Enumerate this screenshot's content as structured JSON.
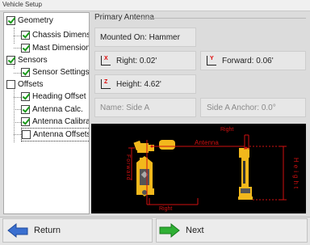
{
  "window": {
    "title": "Vehicle Setup"
  },
  "tree": {
    "items": [
      {
        "label": "Geometry",
        "checked": true
      },
      {
        "label": "Chassis Dimensions",
        "checked": true
      },
      {
        "label": "Mast Dimensions",
        "checked": true
      },
      {
        "label": "Sensors",
        "checked": true
      },
      {
        "label": "Sensor Settings",
        "checked": true
      },
      {
        "label": "Offsets",
        "checked": false
      },
      {
        "label": "Heading Offset",
        "checked": true
      },
      {
        "label": "Antenna Calc.",
        "checked": true
      },
      {
        "label": "Antenna Calibration",
        "checked": true
      },
      {
        "label": "Antenna Offsets",
        "checked": false
      }
    ]
  },
  "panel": {
    "title": "Primary Antenna",
    "mounted_on": "Mounted On: Hammer",
    "right": "Right: 0.02'",
    "forward": "Forward: 0.06'",
    "height": "Height: 4.62'",
    "name": "Name: Side A",
    "anchor": "Side A Anchor: 0.0°",
    "axis_x": "X",
    "axis_y": "Y",
    "axis_z": "Z"
  },
  "diagram": {
    "label_antenna": "Antenna",
    "label_right_top": "Right",
    "label_right_bottom": "Right",
    "label_forward": "Forward",
    "label_height": "Height",
    "colors": {
      "machine": "#f2b81c",
      "dimension": "#d01010",
      "background": "#000000"
    }
  },
  "footer": {
    "return_label": "Return",
    "next_label": "Next"
  }
}
